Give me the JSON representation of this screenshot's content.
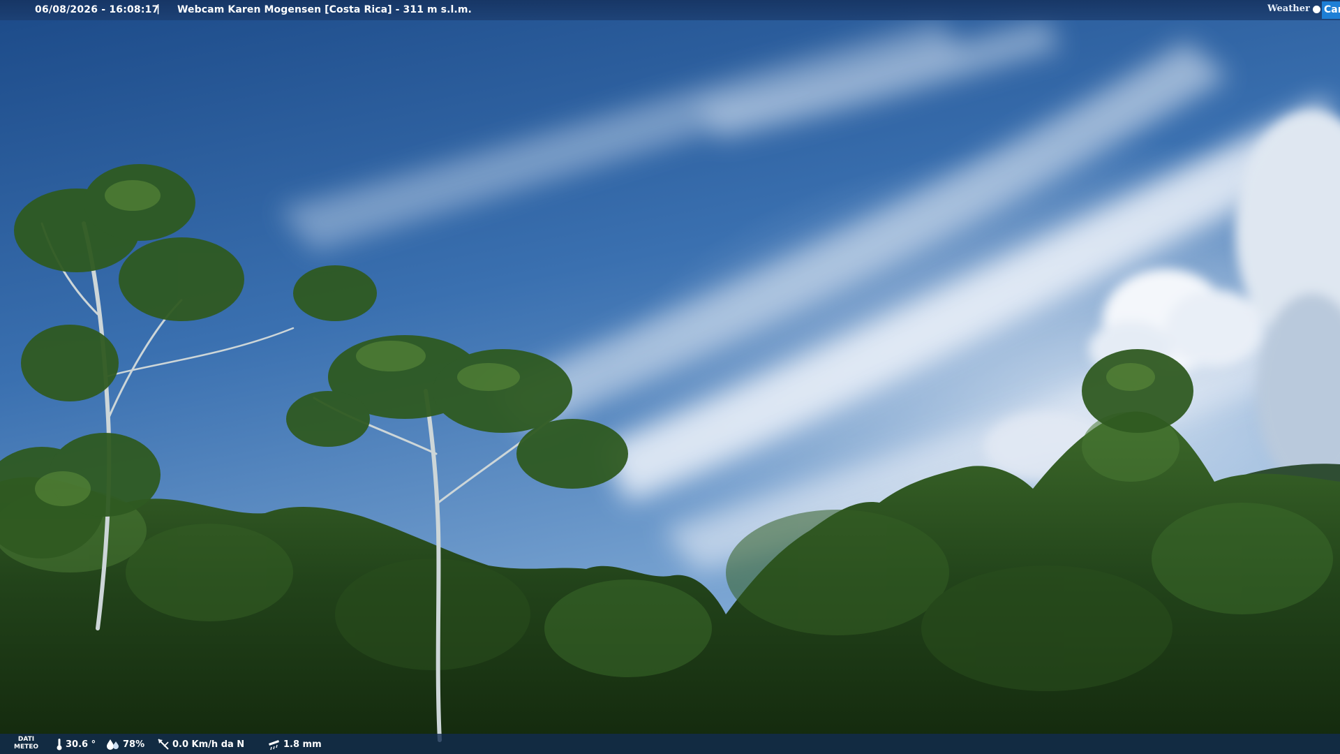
{
  "header": {
    "datetime": "06/08/2026 - 16:08:17",
    "separator": "|",
    "title": "Webcam Karen Mogensen [Costa Rica] - 311 m s.l.m.",
    "brand_word": "Weather",
    "brand_cam": "Cam"
  },
  "footer": {
    "label_line1": "DATI",
    "label_line2": "METEO",
    "temperature": "30.6 °",
    "humidity": "78%",
    "wind": "0.0 Km/h da N",
    "rain": "1.8 mm"
  },
  "icons": {
    "temperature": "thermometer-icon",
    "humidity": "drops-icon",
    "wind": "wind-vane-icon",
    "rain": "rain-gauge-icon"
  },
  "colors": {
    "sky_top": "#1d4d8c",
    "sky_mid": "#3d73b2",
    "sky_low": "#7ba5d3",
    "foliage_dark": "#17300f",
    "foliage_mid": "#2f5a1f",
    "foliage_light": "#5a8a3a",
    "accent_brand": "#1e7fd6"
  }
}
